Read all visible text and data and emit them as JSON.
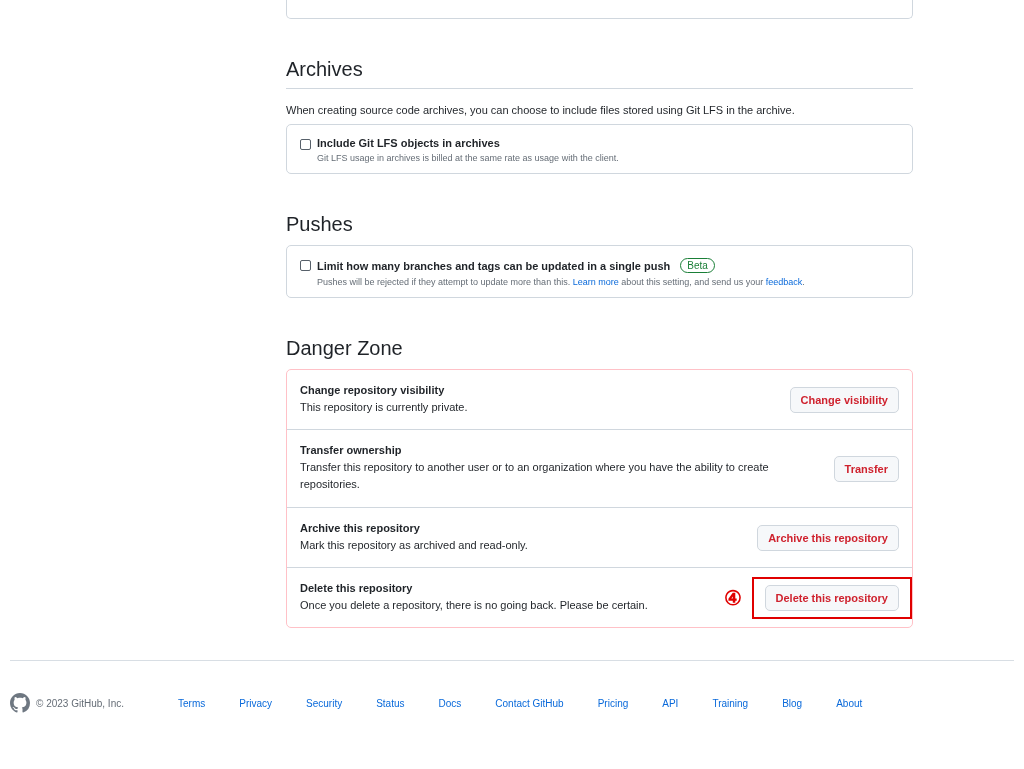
{
  "archives": {
    "heading": "Archives",
    "description": "When creating source code archives, you can choose to include files stored using Git LFS in the archive.",
    "options": [
      {
        "label": "Include Git LFS objects in archives",
        "checked": false,
        "note": "Git LFS usage in archives is billed at the same rate as usage with the client."
      }
    ]
  },
  "pushes": {
    "heading": "Pushes",
    "options": [
      {
        "label": "Limit how many branches and tags can be updated in a single push",
        "badge": "Beta",
        "checked": false,
        "note_parts": [
          {
            "kind": "text",
            "text": "Pushes will be rejected if they attempt to update more than this. "
          },
          {
            "kind": "link",
            "text": "Learn more"
          },
          {
            "kind": "text",
            "text": " about this setting, and send us your "
          },
          {
            "kind": "link",
            "text": "feedback"
          },
          {
            "kind": "text",
            "text": "."
          }
        ]
      }
    ]
  },
  "danger_zone": {
    "heading": "Danger Zone",
    "items": [
      {
        "title": "Change repository visibility",
        "description": "This repository is currently private.",
        "button": "Change visibility",
        "highlighted": false
      },
      {
        "title": "Transfer ownership",
        "description": "Transfer this repository to another user or to an organization where you have the ability to create repositories.",
        "button": "Transfer",
        "highlighted": false
      },
      {
        "title": "Archive this repository",
        "description": "Mark this repository as archived and read-only.",
        "button": "Archive this repository",
        "highlighted": false
      },
      {
        "title": "Delete this repository",
        "description": "Once you delete a repository, there is no going back. Please be certain.",
        "button": "Delete this repository",
        "highlighted": true,
        "marker": "④"
      }
    ]
  },
  "footer": {
    "copyright": "© 2023 GitHub, Inc.",
    "links": [
      "Terms",
      "Privacy",
      "Security",
      "Status",
      "Docs",
      "Contact GitHub",
      "Pricing",
      "API",
      "Training",
      "Blog",
      "About"
    ]
  }
}
